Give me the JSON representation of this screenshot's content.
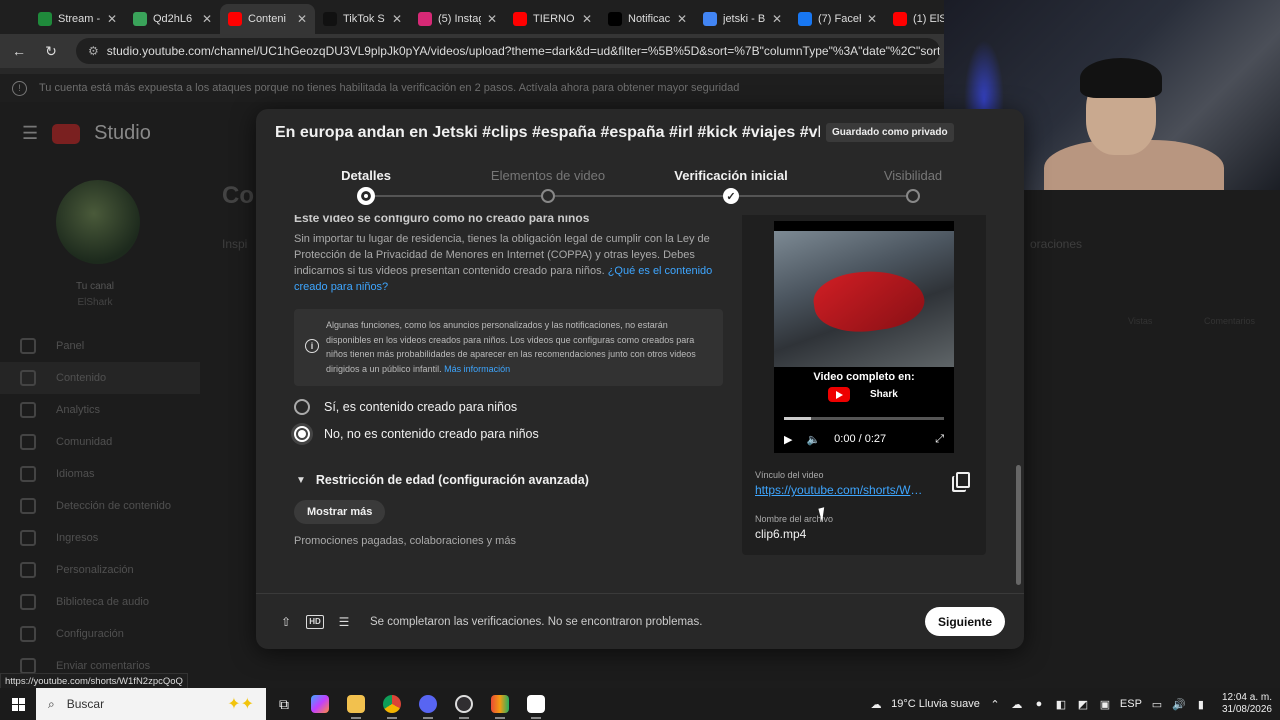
{
  "browser": {
    "tabs": [
      {
        "title": "Stream -",
        "color": "#1f8a3b",
        "active": false
      },
      {
        "title": "Qd2hL6",
        "color": "#3aa35a",
        "active": false
      },
      {
        "title": "Conteni",
        "color": "#ff0000",
        "active": true
      },
      {
        "title": "TikTok S",
        "color": "#111111",
        "active": false
      },
      {
        "title": "(5) Instag",
        "color": "#d62976",
        "active": false
      },
      {
        "title": "TIERNO",
        "color": "#ff0000",
        "active": false
      },
      {
        "title": "Notificac",
        "color": "#000000",
        "active": false
      },
      {
        "title": "jetski - B",
        "color": "#4285f4",
        "active": false
      },
      {
        "title": "(7) Faceb",
        "color": "#1877f2",
        "active": false
      },
      {
        "title": "(1) ElSha",
        "color": "#ff0000",
        "active": false
      }
    ],
    "url": "studio.youtube.com/channel/UC1hGeozqDU3VL9plpJk0pYA/videos/upload?theme=dark&d=ud&filter=%5B%5D&sort=%7B\"columnType\"%3A\"date\"%2C\"sortOrder\"%",
    "security_warning": "Tu cuenta está más expuesta a los ataques porque no tienes habilitada la verificación en 2 pasos. Actívala ahora para obtener mayor seguridad",
    "status_link": "https://youtube.com/shorts/W1fN2zpcQoQ"
  },
  "studio_bg": {
    "logo_text": "Studio",
    "channel_name": "Tu canal",
    "channel_handle": "ElShark",
    "page_title": "Co",
    "tab_inspiration": "Inspi",
    "tab_collabs": "oraciones",
    "col_views": "Vistas",
    "col_comments": "Comentarios",
    "sidebar": [
      "Panel",
      "Contenido",
      "Analytics",
      "Comunidad",
      "Idiomas",
      "Detección de contenido",
      "Ingresos",
      "Personalización",
      "Biblioteca de audio",
      "Configuración",
      "Enviar comentarios"
    ]
  },
  "modal": {
    "title": "En europa andan en Jetski #clips #españa #españa #irl #kick #viajes #vlo...",
    "saved_badge": "Guardado como privado",
    "steps": [
      {
        "label": "Detalles",
        "state": "current"
      },
      {
        "label": "Elementos de video",
        "state": "pending"
      },
      {
        "label": "Verificación inicial",
        "state": "done"
      },
      {
        "label": "Visibilidad",
        "state": "pending"
      }
    ],
    "partial_heading": "Este video se configuró como no creado para niños",
    "coppa_text": "Sin importar tu lugar de residencia, tienes la obligación legal de cumplir con la Ley de Protección de la Privacidad de Menores en Internet (COPPA) y otras leyes. Debes indicarnos si tus videos presentan contenido creado para niños.",
    "coppa_link": "¿Qué es el contenido creado para niños?",
    "info_text": "Algunas funciones, como los anuncios personalizados y las notificaciones, no estarán disponibles en los videos creados para niños. Los videos que configuras como creados para niños tienen más probabilidades de aparecer en las recomendaciones junto con otros videos dirigidos a un público infantil.",
    "info_link": "Más información",
    "radio_yes": "Sí, es contenido creado para niños",
    "radio_no": "No, no es contenido creado para niños",
    "age_restriction": "Restricción de edad (configuración avanzada)",
    "show_more": "Mostrar más",
    "promo_text": "Promociones pagadas, colaboraciones y más",
    "preview": {
      "overlay_text": "Video completo en:",
      "channel": "Shark",
      "time": "0:00 / 0:27",
      "progress": 0.17,
      "link_label": "Vínculo del video",
      "link_url": "https://youtube.com/shorts/W1fN2zpcQoQ",
      "file_label": "Nombre del archivo",
      "file_name": "clip6.mp4"
    },
    "footer_status": "Se completaron las verificaciones. No se encontraron problemas.",
    "next_button": "Siguiente"
  },
  "taskbar": {
    "search_placeholder": "Buscar",
    "weather": "19°C  Lluvia suave",
    "lang": "ESP",
    "time": "12:04 a. m.",
    "date": "31/08/2026"
  }
}
